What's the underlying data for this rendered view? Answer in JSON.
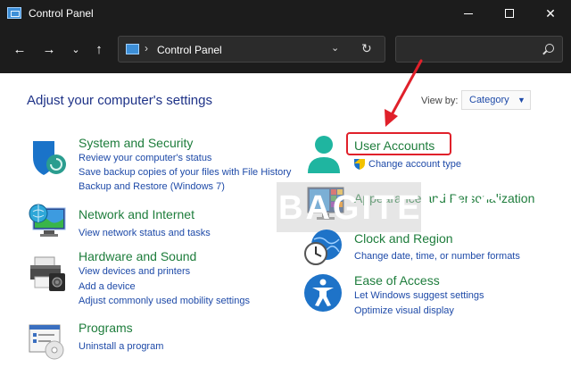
{
  "window": {
    "title": "Control Panel"
  },
  "nav": {
    "address": "Control Panel",
    "search_placeholder": ""
  },
  "content": {
    "heading": "Adjust your computer's settings",
    "view_by_label": "View by:",
    "view_by_value": "Category"
  },
  "categories": {
    "system": {
      "title": "System and Security",
      "links": [
        "Review your computer's status",
        "Save backup copies of your files with File History",
        "Backup and Restore (Windows 7)"
      ]
    },
    "network": {
      "title": "Network and Internet",
      "links": [
        "View network status and tasks"
      ]
    },
    "hardware": {
      "title": "Hardware and Sound",
      "links": [
        "View devices and printers",
        "Add a device",
        "Adjust commonly used mobility settings"
      ]
    },
    "programs": {
      "title": "Programs",
      "links": [
        "Uninstall a program"
      ]
    },
    "user_accounts": {
      "title": "User Accounts",
      "links": [
        "Change account type"
      ]
    },
    "appearance": {
      "title": "Appearance and Personalization",
      "links": []
    },
    "clock": {
      "title": "Clock and Region",
      "links": [
        "Change date, time, or number formats"
      ]
    },
    "ease": {
      "title": "Ease of Access",
      "links": [
        "Let Windows suggest settings",
        "Optimize visual display"
      ]
    }
  },
  "watermark": "BAGITEKNO",
  "colors": {
    "title_green": "#1e7d3c",
    "link_blue": "#1e4aa8",
    "heading_navy": "#1e3287",
    "highlight_red": "#e0202a",
    "titlebar_dark": "#1c1c1c"
  }
}
